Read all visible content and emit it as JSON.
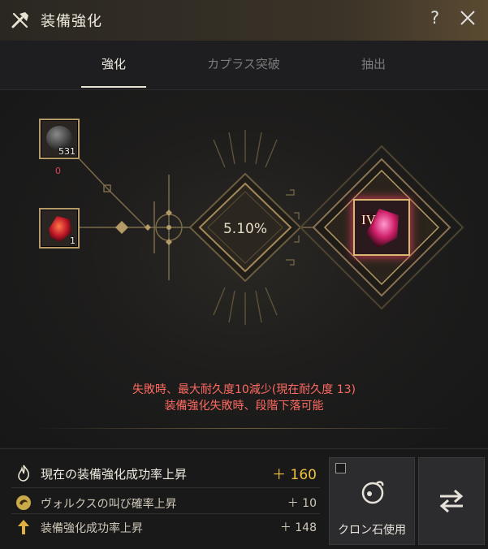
{
  "window": {
    "title": "装備強化",
    "help": "?"
  },
  "tabs": [
    {
      "label": "強化",
      "active": true
    },
    {
      "label": "カプラス突破",
      "active": false
    },
    {
      "label": "抽出",
      "active": false
    }
  ],
  "materials": {
    "stone": {
      "count": "531",
      "required": "0"
    },
    "gem": {
      "count": "1"
    }
  },
  "target": {
    "tier": "IV"
  },
  "success_rate": "5.10%",
  "warnings": [
    "失敗時、最大耐久度10減少(現在耐久度 13)",
    "装備強化失敗時、段階下落可能"
  ],
  "bonuses": [
    {
      "label": "現在の装備強化成功率上昇",
      "value": "＋ 160"
    },
    {
      "label": "ヴォルクスの叫び確率上昇",
      "value": "＋ 10"
    },
    {
      "label": "装備強化成功率上昇",
      "value": "＋ 148"
    }
  ],
  "buttons": {
    "cron_label": "クロン石使用"
  },
  "colors": {
    "accent_gold": "#b39a66",
    "warning_red": "#ff6a62",
    "value_yellow": "#f0c040"
  }
}
